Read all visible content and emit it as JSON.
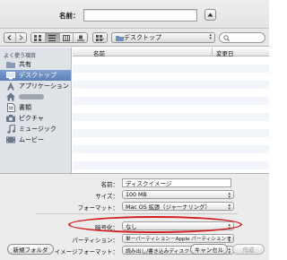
{
  "header": {
    "name_label": "名前："
  },
  "toolbar": {
    "location": "デスクトップ"
  },
  "sidebar": {
    "heading": "よく使う項目",
    "items": [
      {
        "label": "共有",
        "icon": "folder-icon"
      },
      {
        "label": "デスクトップ",
        "icon": "desktop-icon",
        "selected": true
      },
      {
        "label": "アプリケーション",
        "icon": "applications-icon"
      },
      {
        "label": "",
        "icon": "home-icon",
        "redacted": true
      },
      {
        "label": "書類",
        "icon": "documents-icon"
      },
      {
        "label": "ピクチャ",
        "icon": "pictures-icon"
      },
      {
        "label": "ミュージック",
        "icon": "music-icon"
      },
      {
        "label": "ムービー",
        "icon": "movies-icon"
      }
    ]
  },
  "file_list": {
    "columns": [
      "名前",
      "変更日"
    ]
  },
  "form": {
    "name_label": "名前：",
    "name_value": "ディスクイメージ",
    "size_label": "サイズ：",
    "size_value": "100 MB",
    "format_label": "フォーマット：",
    "format_value": "Mac OS 拡張（ジャーナリング）",
    "encryption_label": "暗号化：",
    "encryption_value": "なし",
    "partition_label": "パーティション：",
    "partition_value": "単一パーティション－Apple パーティションマップ",
    "image_format_label": "イメージフォーマット：",
    "image_format_value": "読み出し/書き込みディスクイメージ"
  },
  "buttons": {
    "new_folder": "新規フォルダ",
    "cancel": "キャンセル",
    "create": "作成"
  },
  "colors": {
    "selection": "#5b7fb7",
    "highlight_ring": "#d21e1e"
  }
}
